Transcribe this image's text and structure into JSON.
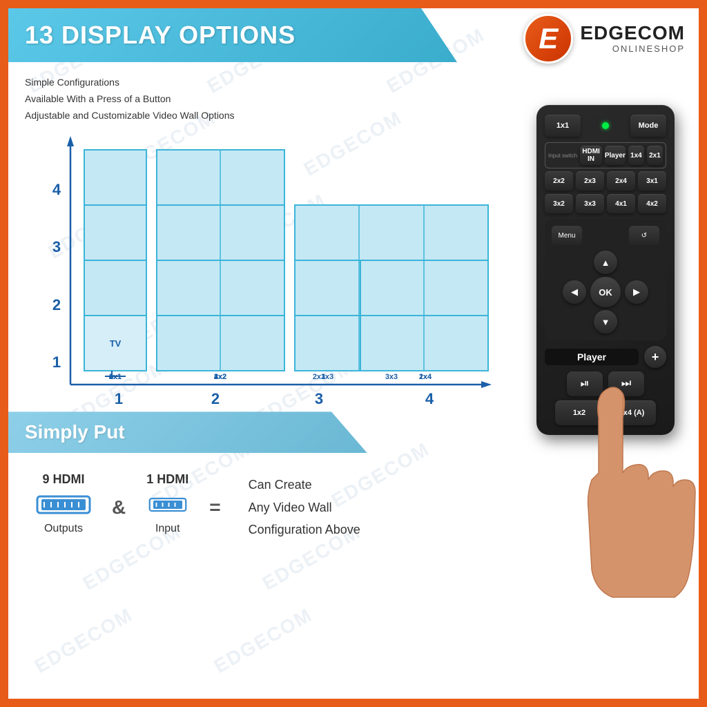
{
  "brand": {
    "name": "EDGECOM",
    "subtitle": "ONLINESHOP",
    "logo_letter": "E"
  },
  "header": {
    "title": "13 DISPLAY OPTIONS"
  },
  "description": {
    "line1": "Simple Configurations",
    "line2": "Available With a Press of a Button",
    "line3": "Adjustable and Customizable Video Wall Options"
  },
  "chart": {
    "y_labels": [
      "1",
      "2",
      "3",
      "4"
    ],
    "x_labels": [
      "1",
      "2",
      "3",
      "4"
    ],
    "cell_labels": [
      "4x1",
      "4x2",
      "3x1",
      "3x2",
      "3x3",
      "2x1",
      "2x2",
      "2x3",
      "2x4",
      "TV",
      "1x2",
      "1x3",
      "1x4"
    ]
  },
  "simply_put": {
    "title": "Simply Put"
  },
  "bottom": {
    "hdmi_out_count": "9 HDMI",
    "hdmi_out_label": "Outputs",
    "hdmi_in_count": "1 HDMI",
    "hdmi_in_label": "Input",
    "connector": "&",
    "equals": "=",
    "result_line1": "Can Create",
    "result_line2": "Any Video Wall",
    "result_line3": "Configuration Above"
  },
  "remote": {
    "btn_1x1": "1x1",
    "btn_mode": "Mode",
    "btn_hdmi_in": "HDMI IN",
    "btn_player": "Player",
    "btn_1x4": "1x4",
    "btn_2x1": "2x1",
    "btn_2x2": "2x2",
    "btn_2x3": "2x3",
    "btn_2x4": "2x4",
    "btn_3x1": "3x1",
    "btn_3x2": "3x2",
    "btn_3x3": "3x3",
    "btn_4x1": "4x1",
    "btn_4x2": "4x2",
    "btn_menu": "Menu",
    "btn_ok": "OK",
    "btn_player_label": "Player",
    "btn_1x2_b": "1x2",
    "btn_4x4a": "4x4 (A)",
    "input_switch_label": "Input switch"
  },
  "watermarks": [
    "EDGECOM",
    "EDGECOM",
    "EDGECOM",
    "EDGECOM",
    "EDGECOM",
    "EDGECOM",
    "EDGECOM",
    "EDGECOM",
    "EDGECOM",
    "EDGECOM",
    "EDGECOM",
    "EDGECOM"
  ]
}
